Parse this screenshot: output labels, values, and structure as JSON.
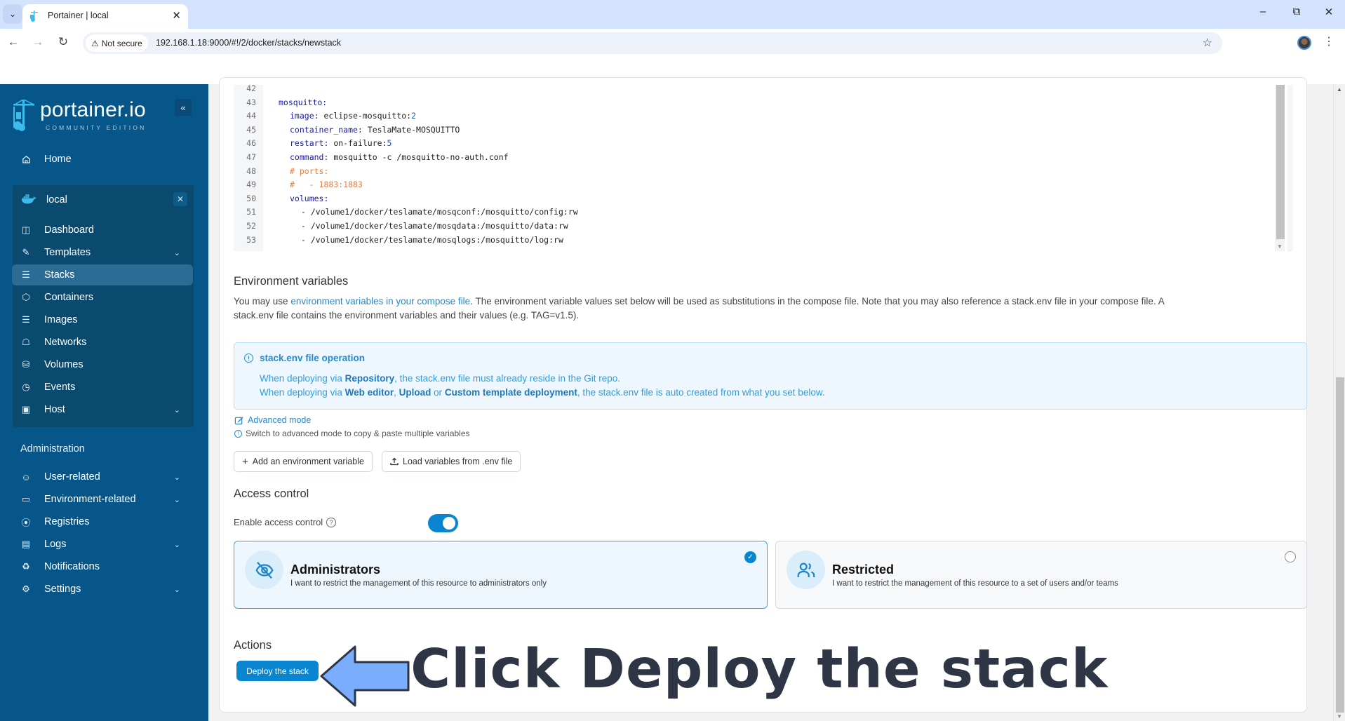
{
  "browser": {
    "tab_title": "Portainer | local",
    "not_secure_label": "Not secure",
    "url": "192.168.1.18:9000/#!/2/docker/stacks/newstack"
  },
  "sidebar": {
    "logo_text": "portainer.io",
    "logo_subtext": "COMMUNITY EDITION",
    "home_label": "Home",
    "environment": {
      "name": "local",
      "items": [
        {
          "label": "Dashboard",
          "icon": "dashboard-icon",
          "has_chevron": false,
          "active": false
        },
        {
          "label": "Templates",
          "icon": "edit-icon",
          "has_chevron": true,
          "active": false
        },
        {
          "label": "Stacks",
          "icon": "layers-icon",
          "has_chevron": false,
          "active": true
        },
        {
          "label": "Containers",
          "icon": "box-icon",
          "has_chevron": false,
          "active": false
        },
        {
          "label": "Images",
          "icon": "list-icon",
          "has_chevron": false,
          "active": false
        },
        {
          "label": "Networks",
          "icon": "network-icon",
          "has_chevron": false,
          "active": false
        },
        {
          "label": "Volumes",
          "icon": "database-icon",
          "has_chevron": false,
          "active": false
        },
        {
          "label": "Events",
          "icon": "clock-icon",
          "has_chevron": false,
          "active": false
        },
        {
          "label": "Host",
          "icon": "host-icon",
          "has_chevron": true,
          "active": false
        }
      ]
    },
    "admin_heading": "Administration",
    "admin_items": [
      {
        "label": "User-related",
        "icon": "users-icon",
        "has_chevron": true
      },
      {
        "label": "Environment-related",
        "icon": "hard-drive-icon",
        "has_chevron": true
      },
      {
        "label": "Registries",
        "icon": "radio-icon",
        "has_chevron": false
      },
      {
        "label": "Logs",
        "icon": "file-text-icon",
        "has_chevron": true
      },
      {
        "label": "Notifications",
        "icon": "bell-icon",
        "has_chevron": false
      },
      {
        "label": "Settings",
        "icon": "gear-icon",
        "has_chevron": true
      }
    ]
  },
  "editor": {
    "lines": [
      {
        "num": "42",
        "indent": 0,
        "parts": []
      },
      {
        "num": "43",
        "indent": 0,
        "parts": [
          {
            "t": "mosquitto:",
            "c": "k"
          }
        ]
      },
      {
        "num": "44",
        "indent": 1,
        "parts": [
          {
            "t": "image:",
            "c": "k"
          },
          {
            "t": " eclipse-mosquitto:",
            "c": ""
          },
          {
            "t": "2",
            "c": "n"
          }
        ]
      },
      {
        "num": "45",
        "indent": 1,
        "parts": [
          {
            "t": "container_name:",
            "c": "k"
          },
          {
            "t": " TeslaMate-MOSQUITTO",
            "c": ""
          }
        ]
      },
      {
        "num": "46",
        "indent": 1,
        "parts": [
          {
            "t": "restart:",
            "c": "k"
          },
          {
            "t": " on-failure:",
            "c": ""
          },
          {
            "t": "5",
            "c": "n"
          }
        ]
      },
      {
        "num": "47",
        "indent": 1,
        "parts": [
          {
            "t": "command:",
            "c": "k"
          },
          {
            "t": " mosquitto -c /mosquitto-no-auth.conf",
            "c": ""
          }
        ]
      },
      {
        "num": "48",
        "indent": 1,
        "parts": [
          {
            "t": "# ports:",
            "c": "c"
          }
        ]
      },
      {
        "num": "49",
        "indent": 1,
        "parts": [
          {
            "t": "#   - 1883:1883",
            "c": "c"
          }
        ]
      },
      {
        "num": "50",
        "indent": 1,
        "parts": [
          {
            "t": "volumes:",
            "c": "k"
          }
        ]
      },
      {
        "num": "51",
        "indent": 2,
        "parts": [
          {
            "t": "- /volume1/docker/teslamate/mosqconf:/mosquitto/config:rw",
            "c": ""
          }
        ]
      },
      {
        "num": "52",
        "indent": 2,
        "parts": [
          {
            "t": "- /volume1/docker/teslamate/mosqdata:/mosquitto/data:rw",
            "c": ""
          }
        ]
      },
      {
        "num": "53",
        "indent": 2,
        "parts": [
          {
            "t": "- /volume1/docker/teslamate/mosqlogs:/mosquitto/log:rw",
            "c": ""
          }
        ]
      }
    ]
  },
  "env_vars": {
    "heading": "Environment variables",
    "desc_prefix": "You may use ",
    "desc_link": "environment variables in your compose file",
    "desc_suffix": ". The environment variable values set below will be used as substitutions in the compose file. Note that you may also reference a stack.env file in your compose file. A",
    "desc_line2": "stack.env file contains the environment variables and their values (e.g. TAG=v1.5).",
    "info_title": "stack.env file operation",
    "info_line1": {
      "pre": "When deploying via ",
      "b1": "Repository",
      "post": ", the stack.env file must already reside in the Git repo."
    },
    "info_line2": {
      "pre": "When deploying via ",
      "b1": "Web editor",
      "mid1": ", ",
      "b2": "Upload",
      "mid2": " or ",
      "b3": "Custom template deployment",
      "post": ", the stack.env file is auto created from what you set below."
    },
    "advanced_mode_label": "Advanced mode",
    "advanced_hint": "Switch to advanced mode to copy & paste multiple variables",
    "add_var_label": "Add an environment variable",
    "load_env_label": "Load variables from .env file"
  },
  "access_control": {
    "heading": "Access control",
    "enable_label": "Enable access control",
    "enabled": true,
    "options": [
      {
        "title": "Administrators",
        "desc": "I want to restrict the management of this resource to administrators only",
        "selected": true
      },
      {
        "title": "Restricted",
        "desc": "I want to restrict the management of this resource to a set of users and/or teams",
        "selected": false
      }
    ]
  },
  "actions": {
    "heading": "Actions",
    "deploy_label": "Deploy the stack"
  },
  "annotation": {
    "text": "Click Deploy the stack",
    "arrow_color": "#7aaefc",
    "text_color": "#2e3645"
  }
}
